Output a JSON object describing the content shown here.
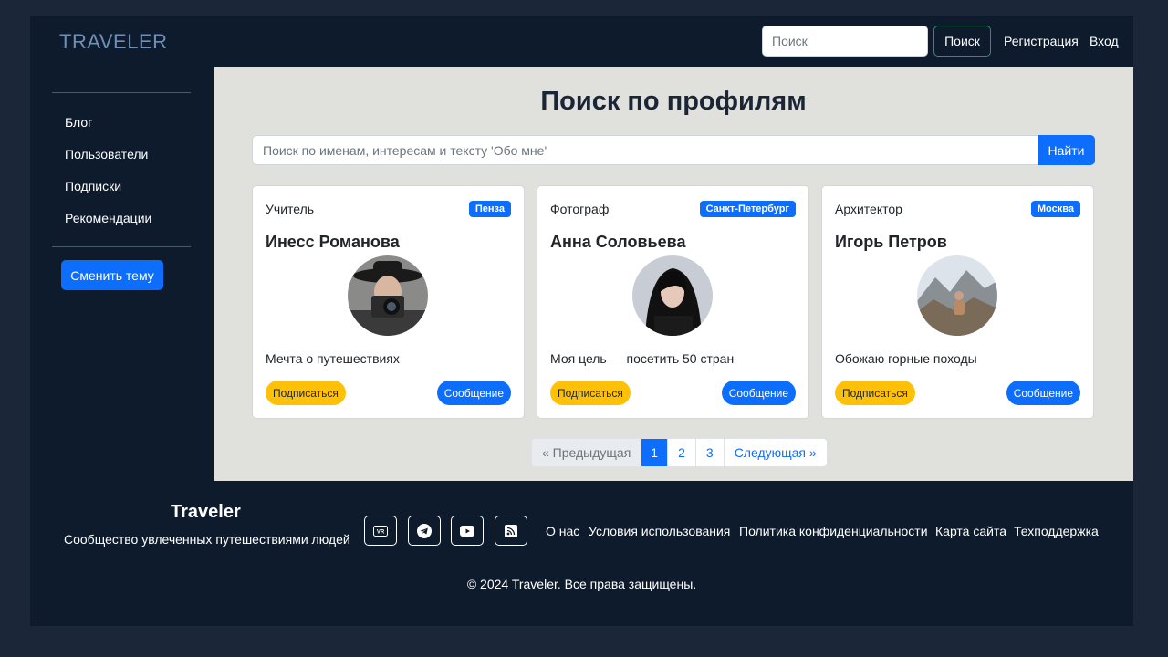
{
  "header": {
    "brand": "TRAVELER",
    "search_placeholder": "Поиск",
    "search_button": "Поиск",
    "register_link": "Регистрация",
    "login_link": "Вход"
  },
  "sidebar": {
    "items": [
      {
        "label": "Блог"
      },
      {
        "label": "Пользователи"
      },
      {
        "label": "Подписки"
      },
      {
        "label": "Рекомендации"
      }
    ],
    "theme_button": "Сменить тему"
  },
  "main": {
    "title": "Поиск по профилям",
    "search_placeholder": "Поиск по именам, интересам и тексту 'Обо мне'",
    "search_button": "Найти",
    "cards": [
      {
        "role": "Учитель",
        "city": "Пенза",
        "name": "Инесс Романова",
        "about": "Мечта о путешествиях",
        "subscribe": "Подписаться",
        "message": "Сообщение"
      },
      {
        "role": "Фотограф",
        "city": "Санкт-Петербург",
        "name": "Анна Соловьева",
        "about": "Моя цель — посетить 50 стран",
        "subscribe": "Подписаться",
        "message": "Сообщение"
      },
      {
        "role": "Архитектор",
        "city": "Москва",
        "name": "Игорь Петров",
        "about": "Обожаю горные походы",
        "subscribe": "Подписаться",
        "message": "Сообщение"
      }
    ],
    "pagination": {
      "prev": "« Предыдущая",
      "pages": [
        "1",
        "2",
        "3"
      ],
      "current_page": "1",
      "next": "Следующая »"
    }
  },
  "footer": {
    "brand": "Traveler",
    "tagline": "Сообщество увлеченных путешествиями людей",
    "social_icons": [
      "vr-icon",
      "telegram-icon",
      "youtube-icon",
      "rss-icon"
    ],
    "links": [
      "О нас",
      "Условия использования",
      "Политика конфиденциальности",
      "Карта сайта",
      "Техподдержка"
    ],
    "copyright": "© 2024 Traveler. Все права защищены."
  },
  "colors": {
    "page_bg": "#1b2638",
    "frame_bg": "#0e1b2c",
    "main_bg": "#e0e0dc",
    "primary": "#0d6efd",
    "warning": "#ffc107",
    "brand": "#6f8fb8"
  }
}
